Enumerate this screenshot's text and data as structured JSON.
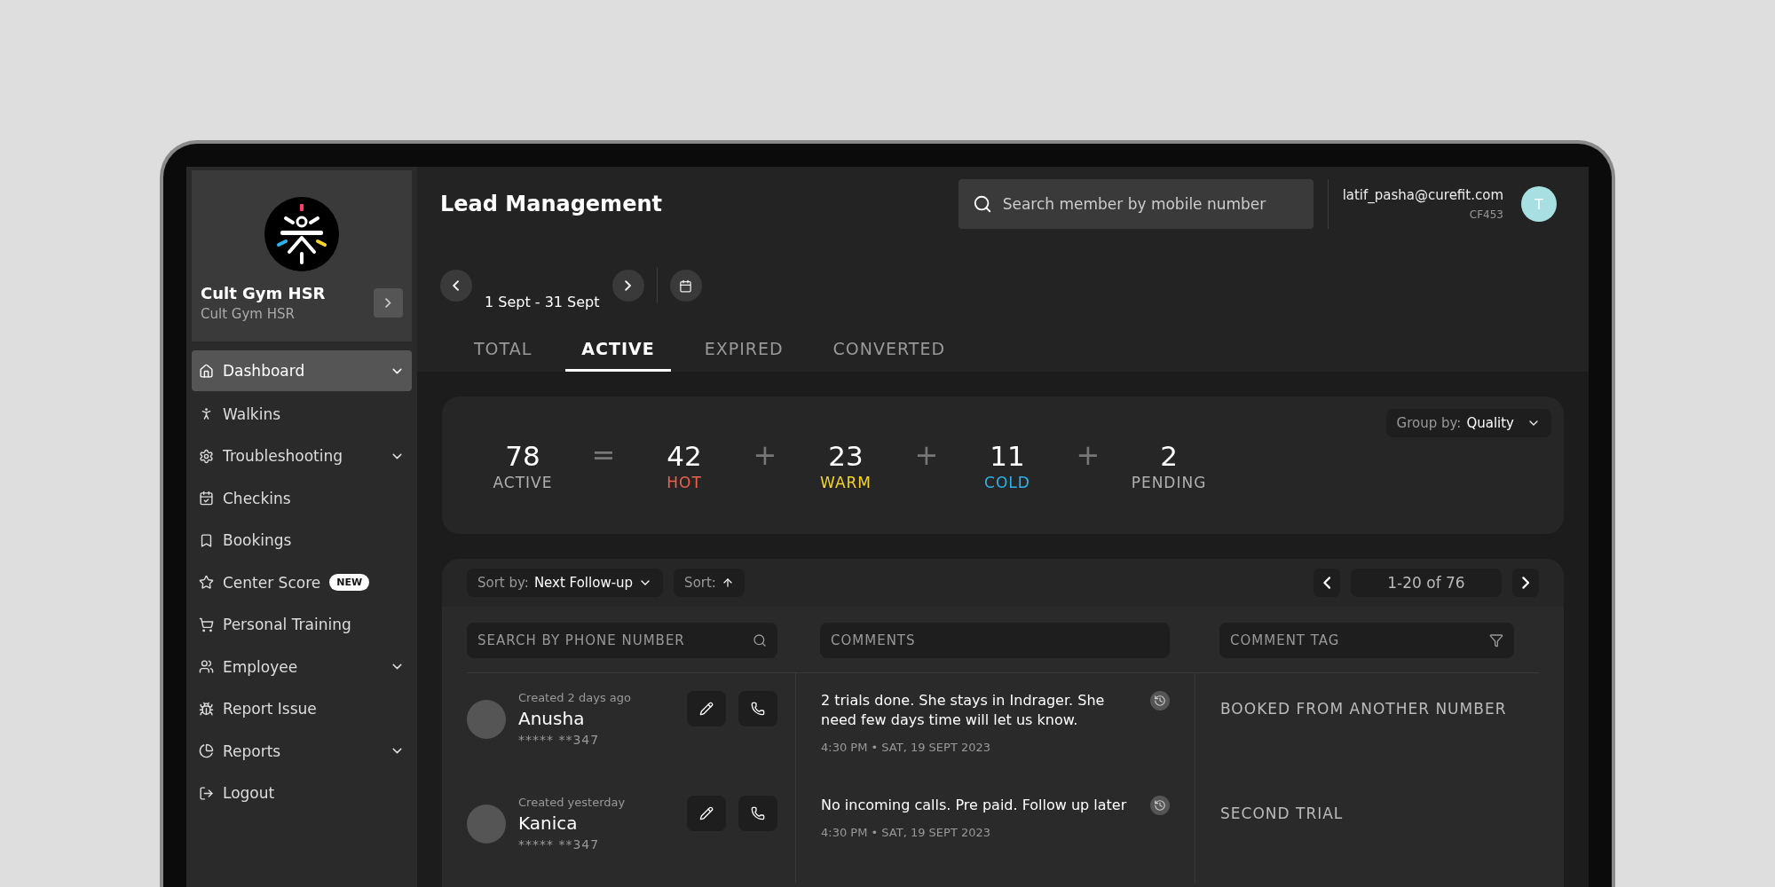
{
  "sidebar": {
    "center": {
      "name": "Cult Gym HSR",
      "subtitle": "Cult Gym HSR"
    },
    "items": [
      {
        "label": "Dashboard",
        "selected": true,
        "has_submenu": true
      },
      {
        "label": "Walkins",
        "selected": false,
        "has_submenu": false
      },
      {
        "label": "Troubleshooting",
        "selected": false,
        "has_submenu": true
      },
      {
        "label": "Checkins",
        "selected": false,
        "has_submenu": false
      },
      {
        "label": "Bookings",
        "selected": false,
        "has_submenu": false
      },
      {
        "label": "Center Score",
        "selected": false,
        "has_submenu": false,
        "badge": "NEW"
      },
      {
        "label": "Personal Training",
        "selected": false,
        "has_submenu": false
      },
      {
        "label": "Employee",
        "selected": false,
        "has_submenu": true
      },
      {
        "label": "Report Issue",
        "selected": false,
        "has_submenu": false
      },
      {
        "label": "Reports",
        "selected": false,
        "has_submenu": true
      },
      {
        "label": "Logout",
        "selected": false,
        "has_submenu": false
      }
    ]
  },
  "header": {
    "title": "Lead Management",
    "search": {
      "placeholder": "Search member by mobile number"
    },
    "user": {
      "email": "latif_pasha@curefit.com",
      "code": "CF453",
      "initial": "T"
    }
  },
  "date_range": "1 Sept - 31 Sept",
  "tabs": [
    {
      "label": "TOTAL",
      "selected": false
    },
    {
      "label": "ACTIVE",
      "selected": true
    },
    {
      "label": "EXPIRED",
      "selected": false
    },
    {
      "label": "CONVERTED",
      "selected": false
    }
  ],
  "summary": {
    "group_by": {
      "label": "Group by:",
      "value": "Quality"
    },
    "stats": [
      {
        "value": "78",
        "label": "ACTIVE",
        "color": "#b0b0b0"
      },
      {
        "operator": "=",
        "value": "42",
        "label": "HOT",
        "color": "#f0604a"
      },
      {
        "operator": "+",
        "value": "23",
        "label": "WARM",
        "color": "#f5d32a"
      },
      {
        "operator": "+",
        "value": "11",
        "label": "COLD",
        "color": "#2ab4ec"
      },
      {
        "operator": "+",
        "value": "2",
        "label": "PENDING",
        "color": "#b0b0b0"
      }
    ]
  },
  "table": {
    "sort": {
      "label": "Sort by:",
      "value": "Next Follow-up"
    },
    "order": {
      "label": "Sort:"
    },
    "pagination": "1-20 of 76",
    "columns": [
      {
        "placeholder": "SEARCH BY PHONE NUMBER"
      },
      {
        "placeholder": "COMMENTS"
      },
      {
        "placeholder": "COMMENT TAG"
      }
    ],
    "rows": [
      {
        "created": "Created 2 days ago",
        "name": "Anusha",
        "phone": "***** **347",
        "comment": "2 trials done. She stays in Indrager. She need few days time will let us know.",
        "time": "4:30 PM • SAT, 19 SEPT 2023",
        "tag": "BOOKED FROM ANOTHER NUMBER"
      },
      {
        "created": "Created yesterday",
        "name": "Kanica",
        "phone": "***** **347",
        "comment": "No incoming calls. Pre paid. Follow up later",
        "time": "4:30 PM • SAT, 19 SEPT 2023",
        "tag": "SECOND TRIAL"
      }
    ]
  }
}
